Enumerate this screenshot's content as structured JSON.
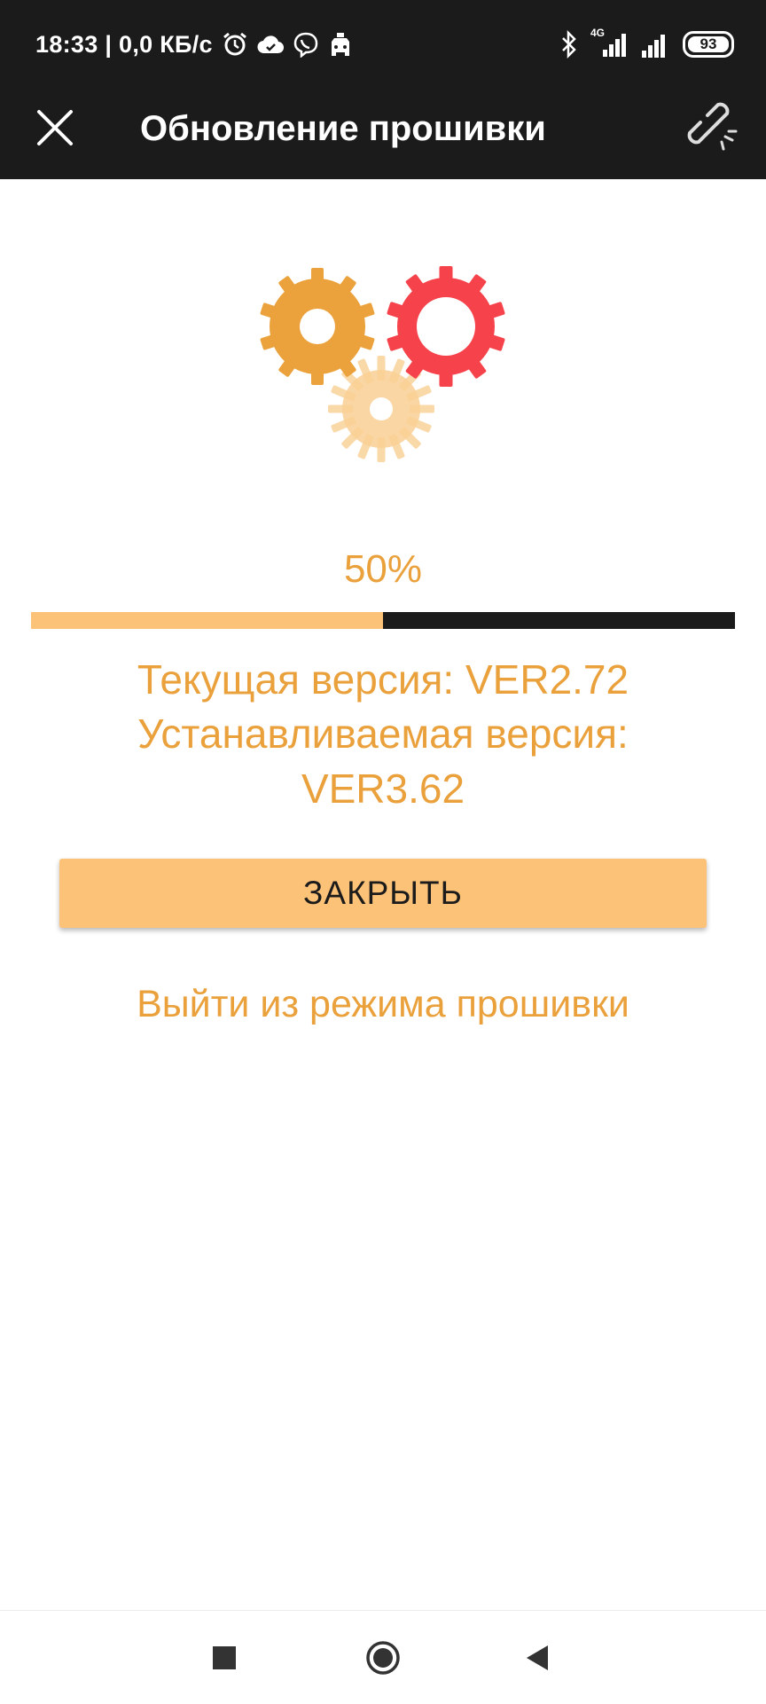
{
  "status_bar": {
    "time_text": "18:33 | 0,0 КБ/с",
    "network_label": "4G",
    "battery_level": "93",
    "icons": [
      "alarm-icon",
      "cloud-icon",
      "viber-icon",
      "taxi-icon",
      "bluetooth-icon",
      "signal-4g-icon",
      "signal-icon",
      "battery-icon"
    ]
  },
  "toolbar": {
    "title": "Обновление прошивки",
    "close_icon": "close-icon",
    "link_icon": "broken-link-icon"
  },
  "progress": {
    "percent_label": "50%",
    "value": 0.5
  },
  "versions": {
    "current": "Текущая версия: VER2.72",
    "target": "Устанавливаемая версия: VER3.62"
  },
  "actions": {
    "close_button": "ЗАКРЫТЬ",
    "exit_link": "Выйти из режима прошивки"
  },
  "colors": {
    "accent_text": "#eaa13c",
    "button": "#fcc277",
    "progress_fill": "#fcc277",
    "progress_track": "#1b1b1b",
    "gear_orange": "#eba23c",
    "gear_red": "#f6424a",
    "gear_light": "#f9cf94",
    "bar_background": "#1b1b1b"
  },
  "navigation": {
    "icons": [
      "recents-square-icon",
      "home-circle-icon",
      "back-triangle-icon"
    ]
  }
}
